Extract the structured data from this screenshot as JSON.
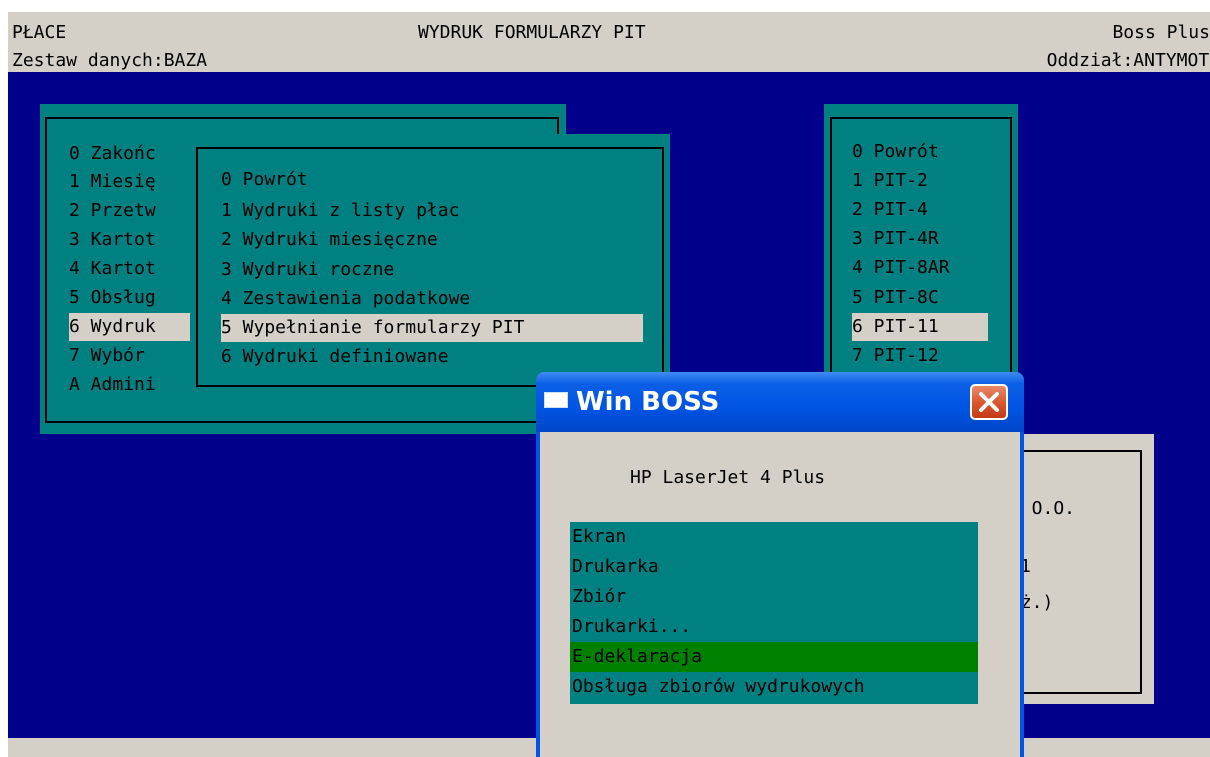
{
  "header": {
    "module": "PŁACE",
    "title": "WYDRUK FORMULARZY PIT",
    "app": "Boss Plus",
    "data_set": "Zestaw danych:BAZA",
    "branch": "Oddział:ANTYMOTO"
  },
  "main_menu": {
    "items": [
      {
        "label": "0 Zakońc"
      },
      {
        "label": "1 Miesię"
      },
      {
        "label": "2 Przetw"
      },
      {
        "label": "3 Kartot"
      },
      {
        "label": "4 Kartot"
      },
      {
        "label": "5 Obsług"
      },
      {
        "label": "6 Wydruk"
      },
      {
        "label": "7 Wybór"
      },
      {
        "label": "A Admini"
      }
    ],
    "selected_index": 6
  },
  "sub_menu": {
    "items": [
      {
        "label": "0 Powrót"
      },
      {
        "label": "1 Wydruki z listy płac"
      },
      {
        "label": "2 Wydruki miesięczne"
      },
      {
        "label": "3 Wydruki roczne"
      },
      {
        "label": "4 Zestawienia podatkowe"
      },
      {
        "label": "5 Wypełnianie formularzy PIT"
      },
      {
        "label": "6 Wydruki definiowane"
      }
    ],
    "selected_index": 5
  },
  "pit_menu": {
    "items": [
      {
        "label": "0 Powrót"
      },
      {
        "label": "1 PIT-2"
      },
      {
        "label": "2 PIT-4"
      },
      {
        "label": "3 PIT-4R"
      },
      {
        "label": "4 PIT-8AR"
      },
      {
        "label": "5 PIT-8C"
      },
      {
        "label": "6 PIT-11"
      },
      {
        "label": "7 PIT-12"
      }
    ],
    "selected_index": 6
  },
  "back_dialog": {
    "line1": "z O.O.",
    "line2": "1",
    "line3": "uż.)"
  },
  "win_boss": {
    "title": "Win BOSS",
    "close_icon": "close-x",
    "printer": "HP LaserJet 4 Plus",
    "options": [
      {
        "label": "Ekran"
      },
      {
        "label": "Drukarka"
      },
      {
        "label": "Zbiór"
      },
      {
        "label": "Drukarki..."
      },
      {
        "label": "E-deklaracja"
      },
      {
        "label": "Obsługa zbiorów wydrukowych"
      }
    ],
    "selected_index": 4
  },
  "colors": {
    "desktop": "#00008b",
    "panel": "#008080",
    "selection": "#d4d0c8",
    "dialog_selection": "#008000",
    "xp_titlebar": "#0054e3",
    "xp_close": "#d9532c"
  }
}
